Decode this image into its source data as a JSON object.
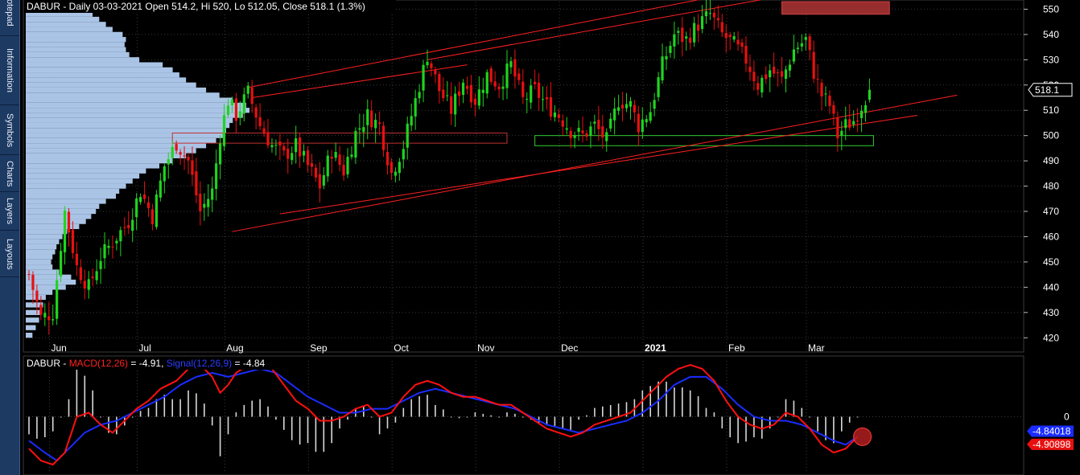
{
  "sidebar": {
    "tabs": [
      {
        "label": "Notepad"
      },
      {
        "label": "Information"
      },
      {
        "label": "Symbols"
      },
      {
        "label": "Charts"
      },
      {
        "label": "Layers"
      },
      {
        "label": "Layouts"
      }
    ]
  },
  "colors": {
    "up": "#1fd41f",
    "down": "#e81010",
    "profile": "#aac4e6",
    "channel": "#ff2020",
    "macd": "#ff1010",
    "signal": "#1a2cff",
    "histogram": "#d8d8d8",
    "zone_green": "#33cc33",
    "zone_red": "#a83232"
  },
  "chart_data": [
    {
      "type": "candlestick",
      "header": {
        "symbol": "DABUR",
        "info": " - Daily 03-03-2021 Open 514.2, Hi 520, Lo 512.05, Close 518.1 (1.3%)"
      },
      "ylim": [
        415,
        553
      ],
      "y_ticks": [
        420,
        430,
        440,
        450,
        460,
        470,
        480,
        490,
        500,
        510,
        520,
        530,
        540,
        550
      ],
      "x_months": [
        {
          "label": "Jun",
          "index": 10
        },
        {
          "label": "Jul",
          "index": 32
        },
        {
          "label": "Aug",
          "index": 54
        },
        {
          "label": "Sep",
          "index": 75
        },
        {
          "label": "Oct",
          "index": 96
        },
        {
          "label": "Nov",
          "index": 117
        },
        {
          "label": "Dec",
          "index": 138
        },
        {
          "label": "2021",
          "index": 159
        },
        {
          "label": "Feb",
          "index": 180
        },
        {
          "label": "Mar",
          "index": 200
        }
      ],
      "last_price_label": "518.1",
      "last_price": 518.1,
      "anchors": [
        [
          0,
          445
        ],
        [
          3,
          428
        ],
        [
          6,
          430
        ],
        [
          9,
          470
        ],
        [
          12,
          448
        ],
        [
          15,
          440
        ],
        [
          18,
          452
        ],
        [
          21,
          458
        ],
        [
          25,
          466
        ],
        [
          28,
          478
        ],
        [
          31,
          468
        ],
        [
          34,
          488
        ],
        [
          37,
          497
        ],
        [
          40,
          490
        ],
        [
          43,
          470
        ],
        [
          46,
          478
        ],
        [
          48,
          500
        ],
        [
          50,
          514
        ],
        [
          52,
          508
        ],
        [
          55,
          517
        ],
        [
          58,
          504
        ],
        [
          61,
          496
        ],
        [
          64,
          492
        ],
        [
          67,
          496
        ],
        [
          70,
          488
        ],
        [
          73,
          480
        ],
        [
          76,
          494
        ],
        [
          79,
          486
        ],
        [
          82,
          501
        ],
        [
          85,
          508
        ],
        [
          88,
          504
        ],
        [
          91,
          485
        ],
        [
          94,
          496
        ],
        [
          97,
          514
        ],
        [
          100,
          532
        ],
        [
          103,
          518
        ],
        [
          106,
          510
        ],
        [
          109,
          522
        ],
        [
          112,
          514
        ],
        [
          115,
          524
        ],
        [
          118,
          520
        ],
        [
          121,
          528
        ],
        [
          124,
          514
        ],
        [
          127,
          518
        ],
        [
          130,
          512
        ],
        [
          133,
          508
        ],
        [
          136,
          502
        ],
        [
          139,
          500
        ],
        [
          142,
          504
        ],
        [
          145,
          498
        ],
        [
          148,
          514
        ],
        [
          151,
          512
        ],
        [
          153,
          504
        ],
        [
          156,
          510
        ],
        [
          159,
          528
        ],
        [
          162,
          540
        ],
        [
          165,
          538
        ],
        [
          168,
          544
        ],
        [
          171,
          548
        ],
        [
          174,
          540
        ],
        [
          177,
          536
        ],
        [
          180,
          530
        ],
        [
          183,
          520
        ],
        [
          186,
          526
        ],
        [
          189,
          522
        ],
        [
          192,
          534
        ],
        [
          195,
          538
        ],
        [
          197,
          525
        ],
        [
          199,
          516
        ],
        [
          201,
          512
        ],
        [
          203,
          500
        ],
        [
          205,
          504
        ],
        [
          207,
          506
        ],
        [
          209,
          512
        ],
        [
          211,
          518.1
        ]
      ],
      "volume_profile": [
        [
          421,
          0.1
        ],
        [
          424,
          0.15
        ],
        [
          427,
          0.2
        ],
        [
          430,
          0.22
        ],
        [
          433,
          0.26
        ],
        [
          436,
          0.3
        ],
        [
          438,
          0.4
        ],
        [
          440,
          0.6
        ],
        [
          442,
          0.75
        ],
        [
          444,
          0.68
        ],
        [
          446,
          0.5
        ],
        [
          448,
          0.4
        ],
        [
          450,
          0.38
        ],
        [
          452,
          0.4
        ],
        [
          454,
          0.44
        ],
        [
          456,
          0.46
        ],
        [
          458,
          0.5
        ],
        [
          460,
          0.55
        ],
        [
          462,
          0.62
        ],
        [
          464,
          0.8
        ],
        [
          466,
          0.9
        ],
        [
          468,
          0.98
        ],
        [
          470,
          1.05
        ],
        [
          472,
          1.1
        ],
        [
          474,
          1.2
        ],
        [
          476,
          1.35
        ],
        [
          478,
          1.4
        ],
        [
          480,
          1.5
        ],
        [
          482,
          1.6
        ],
        [
          484,
          1.7
        ],
        [
          486,
          1.8
        ],
        [
          488,
          2.0
        ],
        [
          490,
          2.2
        ],
        [
          492,
          2.4
        ],
        [
          494,
          2.55
        ],
        [
          496,
          2.7
        ],
        [
          498,
          2.85
        ],
        [
          500,
          2.95
        ],
        [
          502,
          3.0
        ],
        [
          504,
          3.05
        ],
        [
          506,
          3.1
        ],
        [
          508,
          3.25
        ],
        [
          510,
          3.35
        ],
        [
          512,
          3.3
        ],
        [
          514,
          3.1
        ],
        [
          516,
          2.9
        ],
        [
          518,
          2.7
        ],
        [
          520,
          2.55
        ],
        [
          522,
          2.4
        ],
        [
          524,
          2.3
        ],
        [
          526,
          2.2
        ],
        [
          528,
          2.05
        ],
        [
          530,
          1.7
        ],
        [
          532,
          1.55
        ],
        [
          534,
          1.5
        ],
        [
          536,
          1.48
        ],
        [
          538,
          1.5
        ],
        [
          540,
          1.45
        ],
        [
          542,
          1.3
        ],
        [
          544,
          1.2
        ],
        [
          546,
          1.1
        ],
        [
          548,
          1.0
        ],
        [
          550,
          0.85
        ],
        [
          552,
          0.6
        ]
      ],
      "channel_upper": [
        [
          55,
          519
        ],
        [
          208,
          566
        ]
      ],
      "channel_upper2": [
        [
          100,
          530
        ],
        [
          213,
          562
        ]
      ],
      "channel_mid": [
        [
          56,
          515
        ],
        [
          110,
          528
        ]
      ],
      "channel_lower": [
        [
          51,
          462
        ],
        [
          233,
          516
        ]
      ],
      "channel_lower2": [
        [
          63,
          469
        ],
        [
          223,
          508
        ]
      ],
      "zones": [
        {
          "from": [
            36,
            501
          ],
          "to": [
            120,
            497
          ],
          "color": "zone_red_line"
        },
        {
          "from": [
            127,
            500
          ],
          "to": [
            212,
            496
          ],
          "color": "zone_green"
        },
        {
          "from": [
            189,
            553
          ],
          "to": [
            216,
            548
          ],
          "color": "zone_red_fill"
        }
      ]
    },
    {
      "type": "line",
      "header": {
        "symbol": "DABUR",
        "dash": " - ",
        "macd_label": "MACD(12,26)",
        "macd_value": " = -4.91, ",
        "signal_label": "Signal(12,26,9)",
        "signal_value": " = -4.84"
      },
      "zero_label": "0",
      "signal_badge": "-4.84018",
      "macd_badge": "-4.90898",
      "ylim": [
        -14,
        14
      ],
      "macd_anchors": [
        [
          0,
          -8
        ],
        [
          3,
          -11
        ],
        [
          6,
          -12
        ],
        [
          9,
          -9
        ],
        [
          12,
          0
        ],
        [
          15,
          1
        ],
        [
          18,
          -2
        ],
        [
          21,
          -4
        ],
        [
          24,
          -1
        ],
        [
          27,
          2
        ],
        [
          30,
          4
        ],
        [
          33,
          7
        ],
        [
          37,
          9
        ],
        [
          40,
          12
        ],
        [
          43,
          13
        ],
        [
          46,
          10
        ],
        [
          48,
          6
        ],
        [
          50,
          8
        ],
        [
          52,
          11
        ],
        [
          55,
          13
        ],
        [
          58,
          14
        ],
        [
          61,
          12
        ],
        [
          64,
          8
        ],
        [
          67,
          4
        ],
        [
          70,
          2
        ],
        [
          73,
          -1
        ],
        [
          76,
          -1
        ],
        [
          79,
          0
        ],
        [
          82,
          2
        ],
        [
          85,
          3
        ],
        [
          88,
          0
        ],
        [
          91,
          1
        ],
        [
          94,
          5
        ],
        [
          97,
          8
        ],
        [
          100,
          9
        ],
        [
          103,
          8
        ],
        [
          106,
          6
        ],
        [
          109,
          5
        ],
        [
          112,
          5
        ],
        [
          115,
          4
        ],
        [
          118,
          3
        ],
        [
          121,
          3
        ],
        [
          124,
          1
        ],
        [
          127,
          -1
        ],
        [
          130,
          -3
        ],
        [
          133,
          -4
        ],
        [
          136,
          -5
        ],
        [
          139,
          -4
        ],
        [
          142,
          -2
        ],
        [
          145,
          -1
        ],
        [
          148,
          0
        ],
        [
          151,
          1
        ],
        [
          154,
          4
        ],
        [
          157,
          7
        ],
        [
          160,
          10
        ],
        [
          163,
          12
        ],
        [
          166,
          13
        ],
        [
          169,
          12
        ],
        [
          172,
          9
        ],
        [
          175,
          4
        ],
        [
          178,
          0
        ],
        [
          181,
          -2
        ],
        [
          184,
          -3
        ],
        [
          187,
          -2
        ],
        [
          190,
          1
        ],
        [
          193,
          0
        ],
        [
          196,
          -3
        ],
        [
          199,
          -7
        ],
        [
          202,
          -9
        ],
        [
          205,
          -8
        ],
        [
          208,
          -5
        ]
      ],
      "signal_anchors": [
        [
          0,
          -6
        ],
        [
          4,
          -9
        ],
        [
          7,
          -11
        ],
        [
          10,
          -8
        ],
        [
          14,
          -4
        ],
        [
          18,
          -2
        ],
        [
          22,
          -1
        ],
        [
          26,
          1
        ],
        [
          30,
          3
        ],
        [
          34,
          5
        ],
        [
          38,
          8
        ],
        [
          42,
          10
        ],
        [
          46,
          11
        ],
        [
          50,
          10
        ],
        [
          54,
          11
        ],
        [
          58,
          12
        ],
        [
          62,
          11
        ],
        [
          66,
          8
        ],
        [
          70,
          5
        ],
        [
          74,
          3
        ],
        [
          78,
          1
        ],
        [
          82,
          1
        ],
        [
          86,
          2
        ],
        [
          90,
          2
        ],
        [
          94,
          4
        ],
        [
          98,
          6
        ],
        [
          102,
          7
        ],
        [
          106,
          6
        ],
        [
          110,
          5
        ],
        [
          114,
          4
        ],
        [
          118,
          3
        ],
        [
          122,
          2
        ],
        [
          126,
          0
        ],
        [
          130,
          -2
        ],
        [
          134,
          -3
        ],
        [
          138,
          -4
        ],
        [
          142,
          -3
        ],
        [
          146,
          -2
        ],
        [
          150,
          -1
        ],
        [
          154,
          1
        ],
        [
          158,
          4
        ],
        [
          162,
          8
        ],
        [
          166,
          10
        ],
        [
          170,
          10
        ],
        [
          174,
          7
        ],
        [
          178,
          3
        ],
        [
          182,
          0
        ],
        [
          186,
          -1
        ],
        [
          190,
          -1
        ],
        [
          194,
          -2
        ],
        [
          198,
          -4
        ],
        [
          202,
          -6
        ],
        [
          205,
          -7
        ],
        [
          208,
          -5
        ]
      ]
    }
  ]
}
